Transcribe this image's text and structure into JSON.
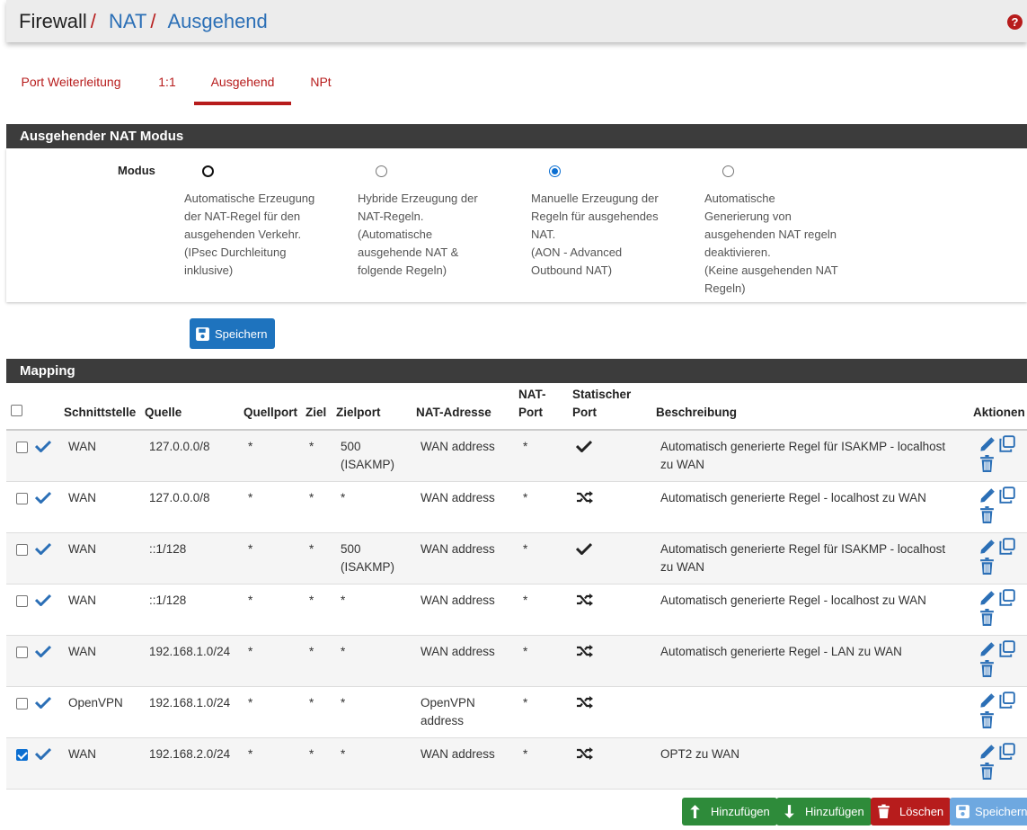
{
  "breadcrumb": {
    "first": "Firewall",
    "second": "NAT",
    "third": "Ausgehend"
  },
  "tabs": [
    {
      "label": "Port Weiterleitung"
    },
    {
      "label": "1:1"
    },
    {
      "label": "Ausgehend",
      "active": true
    },
    {
      "label": "NPt"
    }
  ],
  "mode_panel": {
    "title": "Ausgehender NAT Modus",
    "label": "Modus",
    "options": [
      {
        "lines": [
          "Automatische Erzeugung",
          "der NAT-Regel für den",
          "ausgehenden Verkehr.",
          "(IPsec Durchleitung",
          "inklusive)"
        ],
        "selected": false
      },
      {
        "lines": [
          "Hybride Erzeugung der",
          "NAT-Regeln.",
          "(Automatische",
          "ausgehende NAT &",
          "folgende Regeln)"
        ],
        "selected": false
      },
      {
        "lines": [
          "Manuelle Erzeugung der",
          "Regeln für ausgehendes",
          "NAT.",
          "(AON - Advanced",
          "Outbound NAT)"
        ],
        "selected": true
      },
      {
        "lines": [
          "Automatische",
          "Generierung von",
          "ausgehenden NAT regeln",
          "deaktivieren.",
          "(Keine ausgehenden NAT",
          "Regeln)"
        ],
        "selected": false
      }
    ],
    "save_label": "Speichern"
  },
  "mapping": {
    "title": "Mapping",
    "columns": {
      "interface": "Schnittstelle",
      "source": "Quelle",
      "source_port": "Quellport",
      "dest": "Ziel",
      "dest_port": "Zielport",
      "nat_address": "NAT-Adresse",
      "nat_port_1": "NAT-",
      "nat_port_2": "Port",
      "static_port_1": "Statischer",
      "static_port_2": "Port",
      "description": "Beschreibung",
      "actions": "Aktionen"
    },
    "rows": [
      {
        "checked": false,
        "interface": "WAN",
        "source": "127.0.0.0/8",
        "source_port": "*",
        "dest": "*",
        "dest_port_1": "500",
        "dest_port_2": "(ISAKMP)",
        "nat_1": "WAN address",
        "nat_2": "",
        "nat_port": "*",
        "static": "check",
        "desc_1": "Automatisch generierte Regel für ISAKMP - localhost",
        "desc_2": "zu WAN"
      },
      {
        "checked": false,
        "interface": "WAN",
        "source": "127.0.0.0/8",
        "source_port": "*",
        "dest": "*",
        "dest_port_1": "*",
        "dest_port_2": "",
        "nat_1": "WAN address",
        "nat_2": "",
        "nat_port": "*",
        "static": "random",
        "desc_1": "Automatisch generierte Regel - localhost zu WAN",
        "desc_2": ""
      },
      {
        "checked": false,
        "interface": "WAN",
        "source": "::1/128",
        "source_port": "*",
        "dest": "*",
        "dest_port_1": "500",
        "dest_port_2": "(ISAKMP)",
        "nat_1": "WAN address",
        "nat_2": "",
        "nat_port": "*",
        "static": "check",
        "desc_1": "Automatisch generierte Regel für ISAKMP - localhost",
        "desc_2": "zu WAN"
      },
      {
        "checked": false,
        "interface": "WAN",
        "source": "::1/128",
        "source_port": "*",
        "dest": "*",
        "dest_port_1": "*",
        "dest_port_2": "",
        "nat_1": "WAN address",
        "nat_2": "",
        "nat_port": "*",
        "static": "random",
        "desc_1": "Automatisch generierte Regel - localhost zu WAN",
        "desc_2": ""
      },
      {
        "checked": false,
        "interface": "WAN",
        "source": "192.168.1.0/24",
        "source_port": "*",
        "dest": "*",
        "dest_port_1": "*",
        "dest_port_2": "",
        "nat_1": "WAN address",
        "nat_2": "",
        "nat_port": "*",
        "static": "random",
        "desc_1": "Automatisch generierte Regel - LAN zu WAN",
        "desc_2": ""
      },
      {
        "checked": false,
        "interface": "OpenVPN",
        "source": "192.168.1.0/24",
        "source_port": "*",
        "dest": "*",
        "dest_port_1": "*",
        "dest_port_2": "",
        "nat_1": "OpenVPN",
        "nat_2": "address",
        "nat_port": "*",
        "static": "random",
        "desc_1": "",
        "desc_2": ""
      },
      {
        "checked": true,
        "interface": "WAN",
        "source": "192.168.2.0/24",
        "source_port": "*",
        "dest": "*",
        "dest_port_1": "*",
        "dest_port_2": "",
        "nat_1": "WAN address",
        "nat_2": "",
        "nat_port": "*",
        "static": "random",
        "desc_1": "OPT2 zu WAN",
        "desc_2": ""
      }
    ]
  },
  "footer_buttons": {
    "add_top": "Hinzufügen",
    "add_bottom": "Hinzufügen",
    "delete": "Löschen",
    "save": "Speichern"
  },
  "colors": {
    "accent_red": "#b71c1c",
    "link_blue": "#2b6fb6",
    "panel_dark": "#3c3c3c",
    "button_blue": "#1e73be",
    "button_green": "#2e8b3a"
  }
}
